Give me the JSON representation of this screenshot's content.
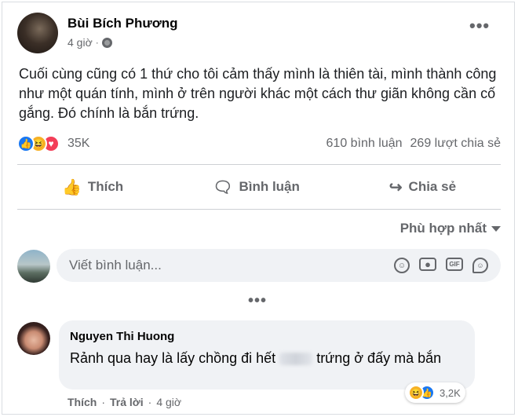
{
  "post": {
    "author": "Bùi Bích Phương",
    "time": "4 giờ",
    "separator": "·",
    "privacy_icon": "globe-icon",
    "more_icon": "•••",
    "text": "Cuối cùng cũng có 1 thứ cho tôi cảm thấy mình là thiên tài, mình thành công như một quán tính, mình ở trên người khác một cách thư giãn không cần cố gắng. Đó chính là bắn trứng."
  },
  "reactions": {
    "icons": [
      "like",
      "haha",
      "love"
    ],
    "count": "35K",
    "comments": "610 bình luận",
    "shares": "269 lượt chia sẻ"
  },
  "actions": {
    "like": "Thích",
    "comment": "Bình luận",
    "share": "Chia sẻ"
  },
  "sort": {
    "label": "Phù hợp nhất"
  },
  "composer": {
    "placeholder": "Viết bình luận...",
    "icons": [
      "emoji-icon",
      "camera-icon",
      "gif-icon",
      "sticker-icon"
    ]
  },
  "more_comments": "•••",
  "comment": {
    "author": "Nguyen Thi Huong",
    "text_before": "Rảnh qua hay là lấy chồng đi hết ",
    "text_after": " trứng ở đấy mà bắn",
    "reaction_count": "3,2K",
    "like": "Thích",
    "reply": "Trả lời",
    "time": "4 giờ",
    "dot": "·"
  },
  "colors": {
    "like": "#1877f2",
    "haha": "#f7b125",
    "love": "#f33e58",
    "secondary_text": "#65676b",
    "input_bg": "#f0f2f5"
  }
}
